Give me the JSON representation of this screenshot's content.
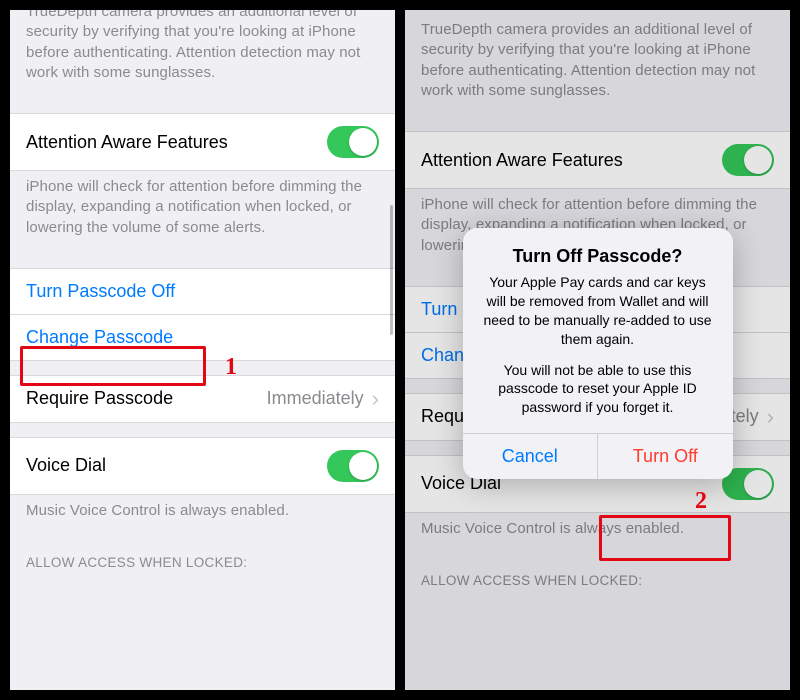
{
  "colors": {
    "link_blue": "#007aff",
    "toggle_green": "#34c759",
    "destructive_red": "#ff3b30",
    "highlight_red": "#e30613"
  },
  "left": {
    "truedepth_footer": "TrueDepth camera provides an additional level of security by verifying that you're looking at iPhone before authenticating. Attention detection may not work with some sunglasses.",
    "attention_row_label": "Attention Aware Features",
    "attention_toggle_on": true,
    "attention_footer": "iPhone will check for attention before dimming the display, expanding a notification when locked, or lowering the volume of some alerts.",
    "turn_passcode_off": "Turn Passcode Off",
    "change_passcode": "Change Passcode",
    "require_passcode_label": "Require Passcode",
    "require_passcode_value": "Immediately",
    "voice_dial_label": "Voice Dial",
    "voice_dial_toggle_on": true,
    "voice_dial_footer": "Music Voice Control is always enabled.",
    "allow_access_header": "ALLOW ACCESS WHEN LOCKED:",
    "step_number": "1"
  },
  "right": {
    "truedepth_footer": "TrueDepth camera provides an additional level of security by verifying that you're looking at iPhone before authenticating. Attention detection may not work with some sunglasses.",
    "attention_row_label": "Attention Aware Features",
    "attention_toggle_on": true,
    "attention_footer_truncated": "iPhone will check for attention before dimming the display, expanding a notification when locked, or lowering the volume of some alerts.",
    "turn_passcode_off_truncated": "Turn Passcode Off",
    "change_passcode_truncated": "Change Passcode",
    "require_passcode_label": "Require Passcode",
    "require_passcode_value": "Immediately",
    "voice_dial_label": "Voice Dial",
    "voice_dial_toggle_on": true,
    "voice_dial_footer": "Music Voice Control is always enabled.",
    "allow_access_header": "ALLOW ACCESS WHEN LOCKED:",
    "alert": {
      "title": "Turn Off Passcode?",
      "message_p1": "Your Apple Pay cards and car keys will be removed from Wallet and will need to be manually re-added to use them again.",
      "message_p2": "You will not be able to use this passcode to reset your Apple ID password if you forget it.",
      "cancel": "Cancel",
      "confirm": "Turn Off"
    },
    "step_number": "2"
  }
}
